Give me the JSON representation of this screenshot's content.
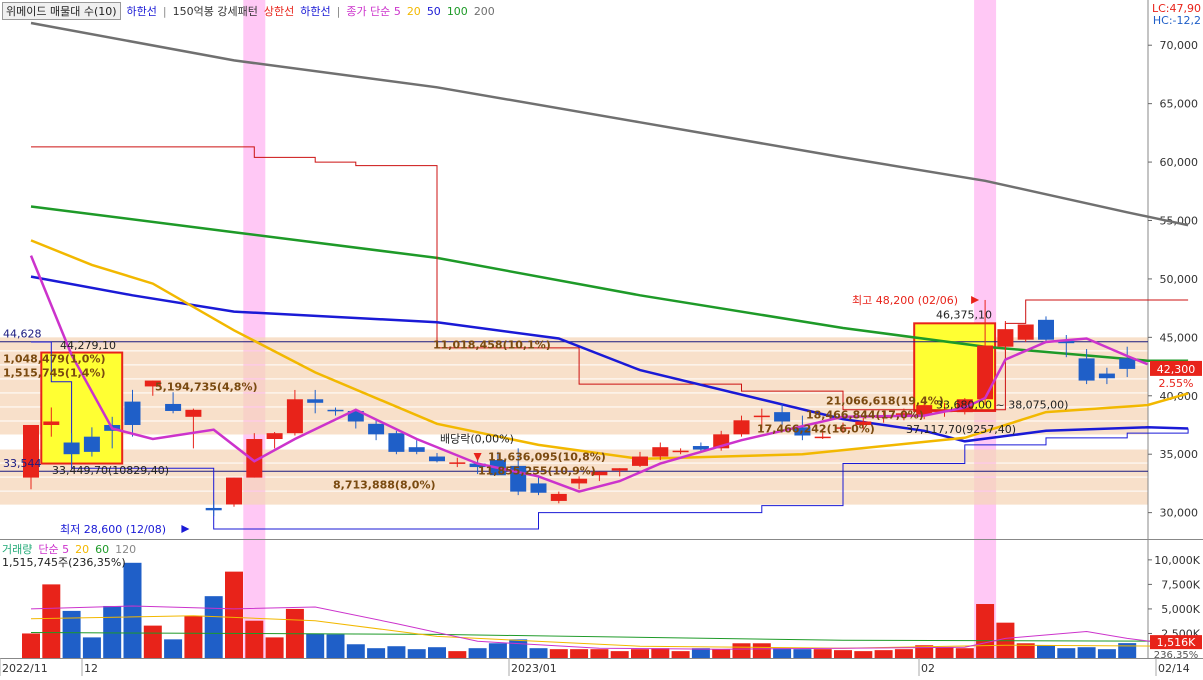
{
  "legend": {
    "indicator_title": "위메이드 매물대 수(10)",
    "lower_band": "하한선",
    "pattern": "150억봉 강세패턴",
    "upper": "상한선",
    "lower": "하한선",
    "ma_label": "종가 단순",
    "ma_periods": [
      "5",
      "20",
      "50",
      "100",
      "200"
    ]
  },
  "corner": {
    "lc": "LC:47,90",
    "hc": "HC:-12,2"
  },
  "volume_legend": {
    "title": "거래량",
    "ma_label": "단순",
    "ma_periods": [
      "5",
      "20",
      "60",
      "120"
    ],
    "summary": "1,515,745주(236,35%)"
  },
  "colors": {
    "up": "#e8231a",
    "down": "#1f5fc8",
    "ma5": "#cc33cc",
    "ma20": "#f2b800",
    "ma50": "#1a1ad6",
    "ma100": "#1e9a28",
    "ma200": "#707070",
    "profile": "#f5d6b8",
    "highlight_band": "#ffc8f5",
    "box": "#ffff33"
  },
  "chart_data": {
    "type": "candlestick",
    "y_axis": {
      "min": 28000,
      "max": 72500,
      "ticks": [
        "70,000",
        "65,000",
        "60,000",
        "55,000",
        "50,000",
        "45,000",
        "40,000",
        "35,000",
        "30,000"
      ]
    },
    "volume_axis": {
      "min": 0,
      "max": 10800,
      "unit": "K",
      "ticks": [
        "10,000K",
        "7,500K",
        "5,000K",
        "2,500K"
      ]
    },
    "x_labels": [
      "2022/11",
      "12",
      "2023/01",
      "02",
      "02/14"
    ],
    "price_tags": {
      "current": "42,300",
      "change_pct": "2.55%",
      "volume_current": "1,516K",
      "volume_pct": "236.35%"
    },
    "candles": [
      {
        "o": 33000,
        "h": 34500,
        "l": 32000,
        "c": 37500,
        "v": 2500
      },
      {
        "o": 37500,
        "h": 39000,
        "l": 36500,
        "c": 37800,
        "v": 7500
      },
      {
        "o": 36000,
        "h": 36800,
        "l": 34000,
        "c": 35000,
        "v": 4800
      },
      {
        "o": 36500,
        "h": 37300,
        "l": 34800,
        "c": 35200,
        "v": 2100
      },
      {
        "o": 37500,
        "h": 38200,
        "l": 35500,
        "c": 37000,
        "v": 5300
      },
      {
        "o": 39500,
        "h": 40500,
        "l": 36500,
        "c": 37500,
        "v": 9700
      },
      {
        "o": 40800,
        "h": 41300,
        "l": 40000,
        "c": 41300,
        "v": 3300
      },
      {
        "o": 39300,
        "h": 40300,
        "l": 38500,
        "c": 38700,
        "v": 1900
      },
      {
        "o": 38200,
        "h": 38900,
        "l": 35500,
        "c": 38800,
        "v": 4300
      },
      {
        "o": 30400,
        "h": 31000,
        "l": 29700,
        "c": 30200,
        "v": 6300
      },
      {
        "o": 30700,
        "h": 33000,
        "l": 30500,
        "c": 33000,
        "v": 8800
      },
      {
        "o": 33000,
        "h": 36800,
        "l": 33000,
        "c": 36300,
        "v": 3800
      },
      {
        "o": 36300,
        "h": 36900,
        "l": 35500,
        "c": 36800,
        "v": 2100
      },
      {
        "o": 36800,
        "h": 40500,
        "l": 36600,
        "c": 39700,
        "v": 5000
      },
      {
        "o": 39700,
        "h": 40500,
        "l": 38500,
        "c": 39400,
        "v": 2500
      },
      {
        "o": 38800,
        "h": 39000,
        "l": 38300,
        "c": 38700,
        "v": 2400
      },
      {
        "o": 38700,
        "h": 38700,
        "l": 37200,
        "c": 37800,
        "v": 1400
      },
      {
        "o": 37600,
        "h": 38000,
        "l": 36200,
        "c": 36700,
        "v": 1000
      },
      {
        "o": 36800,
        "h": 37000,
        "l": 35000,
        "c": 35200,
        "v": 1200
      },
      {
        "o": 35600,
        "h": 36200,
        "l": 35000,
        "c": 35200,
        "v": 900
      },
      {
        "o": 34800,
        "h": 35100,
        "l": 34300,
        "c": 34400,
        "v": 1100
      },
      {
        "o": 34300,
        "h": 34700,
        "l": 33900,
        "c": 34300,
        "v": 700
      },
      {
        "o": 34200,
        "h": 34800,
        "l": 33300,
        "c": 33900,
        "v": 1000
      },
      {
        "o": 34500,
        "h": 35200,
        "l": 33200,
        "c": 33200,
        "v": 1500
      },
      {
        "o": 34000,
        "h": 35500,
        "l": 31500,
        "c": 31800,
        "v": 1900
      },
      {
        "o": 32500,
        "h": 33200,
        "l": 31500,
        "c": 31700,
        "v": 1000
      },
      {
        "o": 31000,
        "h": 31800,
        "l": 30800,
        "c": 31600,
        "v": 900
      },
      {
        "o": 32500,
        "h": 33100,
        "l": 32000,
        "c": 32900,
        "v": 900
      },
      {
        "o": 33200,
        "h": 33500,
        "l": 32700,
        "c": 33500,
        "v": 900
      },
      {
        "o": 33600,
        "h": 33800,
        "l": 33100,
        "c": 33800,
        "v": 700
      },
      {
        "o": 34000,
        "h": 35200,
        "l": 33900,
        "c": 34800,
        "v": 900
      },
      {
        "o": 34800,
        "h": 36000,
        "l": 34500,
        "c": 35600,
        "v": 1000
      },
      {
        "o": 35300,
        "h": 35500,
        "l": 35000,
        "c": 35300,
        "v": 700
      },
      {
        "o": 35700,
        "h": 36000,
        "l": 35200,
        "c": 35400,
        "v": 1000
      },
      {
        "o": 35500,
        "h": 37000,
        "l": 35300,
        "c": 36700,
        "v": 900
      },
      {
        "o": 36700,
        "h": 38300,
        "l": 36500,
        "c": 37900,
        "v": 1500
      },
      {
        "o": 38300,
        "h": 38900,
        "l": 37200,
        "c": 38300,
        "v": 1500
      },
      {
        "o": 38600,
        "h": 39300,
        "l": 37500,
        "c": 37800,
        "v": 1000
      },
      {
        "o": 37300,
        "h": 38300,
        "l": 36200,
        "c": 36600,
        "v": 900
      },
      {
        "o": 36500,
        "h": 37200,
        "l": 36300,
        "c": 36500,
        "v": 900
      },
      {
        "o": 37200,
        "h": 37700,
        "l": 36800,
        "c": 37300,
        "v": 800
      },
      {
        "o": 37500,
        "h": 38200,
        "l": 37100,
        "c": 37800,
        "v": 700
      },
      {
        "o": 38100,
        "h": 38700,
        "l": 37700,
        "c": 38300,
        "v": 800
      },
      {
        "o": 38200,
        "h": 38900,
        "l": 37900,
        "c": 38500,
        "v": 900
      },
      {
        "o": 38400,
        "h": 39500,
        "l": 38000,
        "c": 39200,
        "v": 1300
      },
      {
        "o": 38600,
        "h": 39400,
        "l": 38200,
        "c": 38800,
        "v": 1100
      },
      {
        "o": 38600,
        "h": 39800,
        "l": 38400,
        "c": 39700,
        "v": 1000
      },
      {
        "o": 39700,
        "h": 48200,
        "l": 39200,
        "c": 44300,
        "v": 5500
      },
      {
        "o": 44200,
        "h": 46400,
        "l": 43800,
        "c": 45700,
        "v": 3600
      },
      {
        "o": 44800,
        "h": 46000,
        "l": 44600,
        "c": 46100,
        "v": 1500
      },
      {
        "o": 46500,
        "h": 46800,
        "l": 44600,
        "c": 44800,
        "v": 1300
      },
      {
        "o": 44700,
        "h": 45200,
        "l": 43300,
        "c": 44500,
        "v": 1000
      },
      {
        "o": 43200,
        "h": 44000,
        "l": 41000,
        "c": 41300,
        "v": 1100
      },
      {
        "o": 41900,
        "h": 42400,
        "l": 41000,
        "c": 41500,
        "v": 900
      },
      {
        "o": 43200,
        "h": 44200,
        "l": 41600,
        "c": 42300,
        "v": 1516
      }
    ],
    "profile_zones": [
      {
        "from": 43800,
        "to": 45000,
        "label": "11,018,458(10,1%)"
      },
      {
        "from": 42600,
        "to": 43800,
        "label": "1,048,479(1,0%)"
      },
      {
        "from": 41400,
        "to": 42600,
        "label": "1,515,745(1,4%)"
      },
      {
        "from": 40200,
        "to": 41400,
        "label": "5,194,735(4,8%)"
      },
      {
        "from": 39000,
        "to": 40200,
        "label": "21,066,618(19,4%)"
      },
      {
        "from": 37800,
        "to": 39000,
        "label": "18,466,844(17,0%)"
      },
      {
        "from": 36600,
        "to": 37800,
        "label": "17,466,242(16,0%)"
      },
      {
        "from": 34200,
        "to": 35400,
        "label": "11,636,095(10,8%)"
      },
      {
        "from": 33000,
        "to": 34200,
        "label": "11,855,255(10,9%)"
      },
      {
        "from": 31800,
        "to": 33000,
        "label": "8,713,888(8,0%)"
      },
      {
        "from": 30600,
        "to": 31800,
        "label": ""
      }
    ],
    "annotations": {
      "high": "최고 48,200 (02/06)",
      "low": "최저 28,600 (12/08)",
      "dividend": "배당락(0,00%)",
      "box1_top": "44,279,10",
      "box1_bottom": "33,449,70(10829,40)",
      "box2_top": "46,375,10",
      "box2_bottom": "37,117,70(9257,40)",
      "range": "33,680,00 ~ 38,075,00)",
      "h_line_left_top": "44,628",
      "h_line_left_bottom": "33,544"
    },
    "h_lines": [
      44628,
      33544
    ],
    "ma200": [
      [
        0,
        71900
      ],
      [
        10,
        68700
      ],
      [
        20,
        66400
      ],
      [
        30,
        63400
      ],
      [
        40,
        60400
      ],
      [
        47,
        58400
      ],
      [
        54,
        55700
      ],
      [
        57,
        54600
      ]
    ],
    "ma100": [
      [
        0,
        56200
      ],
      [
        10,
        54000
      ],
      [
        20,
        51800
      ],
      [
        30,
        48600
      ],
      [
        40,
        45800
      ],
      [
        47,
        44200
      ],
      [
        55,
        43000
      ],
      [
        57,
        43000
      ]
    ],
    "ma50": [
      [
        0,
        50200
      ],
      [
        5,
        48600
      ],
      [
        10,
        47200
      ],
      [
        20,
        46300
      ],
      [
        26,
        44900
      ],
      [
        30,
        42200
      ],
      [
        40,
        38000
      ],
      [
        44,
        37000
      ],
      [
        46,
        36100
      ],
      [
        50,
        37000
      ],
      [
        55,
        37300
      ],
      [
        57,
        37200
      ]
    ],
    "ma20": [
      [
        0,
        53300
      ],
      [
        3,
        51200
      ],
      [
        6,
        49600
      ],
      [
        10,
        45600
      ],
      [
        14,
        42000
      ],
      [
        20,
        37600
      ],
      [
        25,
        35800
      ],
      [
        30,
        34600
      ],
      [
        38,
        35000
      ],
      [
        46,
        36400
      ],
      [
        50,
        38600
      ],
      [
        55,
        39200
      ],
      [
        57,
        40200
      ]
    ],
    "ma5": [
      [
        0,
        52000
      ],
      [
        2,
        43500
      ],
      [
        4,
        37200
      ],
      [
        6,
        36300
      ],
      [
        9,
        37100
      ],
      [
        11,
        34400
      ],
      [
        13,
        36300
      ],
      [
        16,
        38800
      ],
      [
        19,
        36300
      ],
      [
        22,
        34200
      ],
      [
        25,
        33100
      ],
      [
        27,
        31800
      ],
      [
        29,
        32700
      ],
      [
        31,
        34200
      ],
      [
        35,
        36200
      ],
      [
        40,
        38200
      ],
      [
        44,
        38300
      ],
      [
        46,
        39000
      ],
      [
        47,
        39800
      ],
      [
        48,
        43100
      ],
      [
        50,
        44600
      ],
      [
        52,
        44900
      ],
      [
        54,
        43400
      ],
      [
        55,
        42700
      ]
    ],
    "envelope_upper": [
      [
        0,
        61300
      ],
      [
        10,
        61300
      ],
      [
        11,
        60400
      ],
      [
        14,
        60000
      ],
      [
        16,
        59700
      ],
      [
        19,
        59700
      ],
      [
        20,
        44100
      ],
      [
        27,
        41000
      ],
      [
        30,
        41000
      ],
      [
        35,
        40400
      ],
      [
        40,
        38800
      ],
      [
        46,
        38800
      ],
      [
        48,
        46200
      ],
      [
        49,
        48200
      ],
      [
        57,
        48200
      ]
    ],
    "envelope_lower": [
      [
        0,
        44600
      ],
      [
        1,
        41200
      ],
      [
        2,
        33800
      ],
      [
        9,
        28600
      ],
      [
        10,
        28600
      ],
      [
        20,
        28600
      ],
      [
        25,
        30000
      ],
      [
        27,
        30000
      ],
      [
        30,
        30000
      ],
      [
        36,
        30600
      ],
      [
        40,
        34200
      ],
      [
        46,
        35800
      ],
      [
        50,
        36400
      ],
      [
        54,
        36800
      ],
      [
        57,
        37200
      ]
    ],
    "pink_bands": [
      11,
      47
    ],
    "volume_ma5": [
      [
        0,
        5000
      ],
      [
        5,
        5300
      ],
      [
        10,
        5000
      ],
      [
        14,
        5200
      ],
      [
        18,
        3500
      ],
      [
        22,
        1700
      ],
      [
        28,
        1000
      ],
      [
        34,
        900
      ],
      [
        40,
        1000
      ],
      [
        46,
        1100
      ],
      [
        48,
        2000
      ],
      [
        52,
        2700
      ],
      [
        54,
        2000
      ],
      [
        57,
        1200
      ]
    ],
    "volume_ma20": [
      [
        0,
        4000
      ],
      [
        8,
        4300
      ],
      [
        14,
        3800
      ],
      [
        20,
        2200
      ],
      [
        30,
        1200
      ],
      [
        40,
        1000
      ],
      [
        48,
        1300
      ],
      [
        57,
        1200
      ]
    ],
    "volume_ma60": [
      [
        0,
        2600
      ],
      [
        20,
        2400
      ],
      [
        40,
        1800
      ],
      [
        57,
        1700
      ]
    ]
  }
}
